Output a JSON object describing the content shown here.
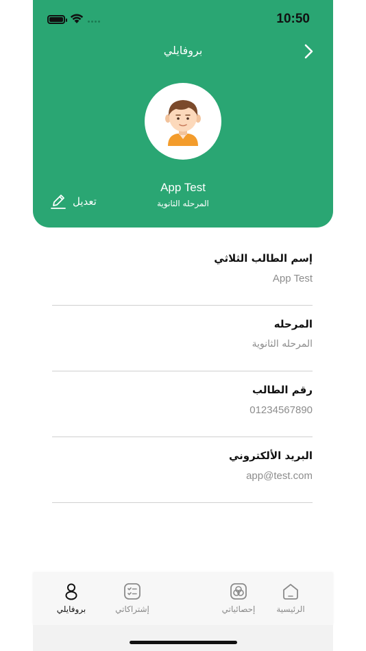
{
  "status_bar": {
    "time": "10:50"
  },
  "header": {
    "title": "بروفايلي",
    "user_name": "App Test",
    "user_stage": "المرحله الثانوية",
    "edit_label": "تعديل"
  },
  "fields": [
    {
      "label": "إسم الطالب الثلاثي",
      "value": "App Test"
    },
    {
      "label": "المرحله",
      "value": "المرحله الثانوية"
    },
    {
      "label": "رقم الطالب",
      "value": "01234567890"
    },
    {
      "label": "البريد الألكتروني",
      "value": "app@test.com"
    }
  ],
  "tabbar": {
    "items": [
      {
        "label": "بروفايلي",
        "icon": "user-icon",
        "active": true
      },
      {
        "label": "إشتراكاتي",
        "icon": "checklist-icon",
        "active": false
      },
      {
        "label": "إحصائياتي",
        "icon": "stats-icon",
        "active": false
      },
      {
        "label": "الرئيسية",
        "icon": "home-icon",
        "active": false
      }
    ]
  },
  "colors": {
    "primary": "#2aa673",
    "label": "#111111",
    "muted": "#8c8c8c"
  }
}
